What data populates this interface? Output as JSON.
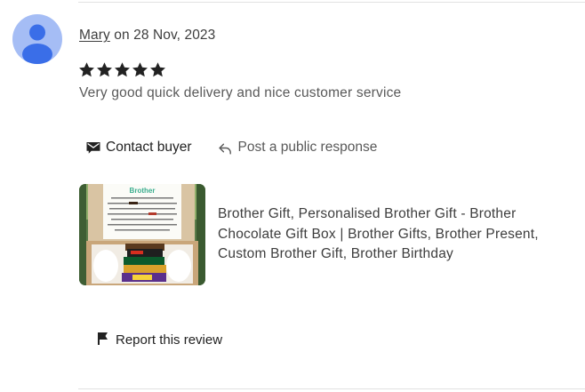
{
  "review": {
    "reviewer_name": "Mary",
    "date_text": "on 28 Nov, 2023",
    "rating": 5,
    "rating_max": 5,
    "text": "Very good quick delivery and nice customer service"
  },
  "actions": {
    "contact_buyer_label": "Contact buyer",
    "public_response_label": "Post a public response"
  },
  "listing": {
    "title": "Brother Gift, Personalised Brother Gift - Brother Chocolate Gift Box | Brother Gifts, Brother Present, Custom Brother Gift, Brother Birthday",
    "thumbnail_heading": "Brother"
  },
  "report": {
    "label": "Report this review"
  },
  "icons": {
    "avatar": "user-avatar-icon",
    "star": "star-icon",
    "contact": "envelope-icon",
    "reply": "reply-arrow-icon",
    "flag": "flag-icon"
  },
  "colors": {
    "avatar_bg": "#a5bdf5",
    "avatar_fg": "#3a6ee8",
    "star": "#222222",
    "text_primary": "#222222",
    "text_secondary": "#595959",
    "divider": "#e1e1e1"
  }
}
